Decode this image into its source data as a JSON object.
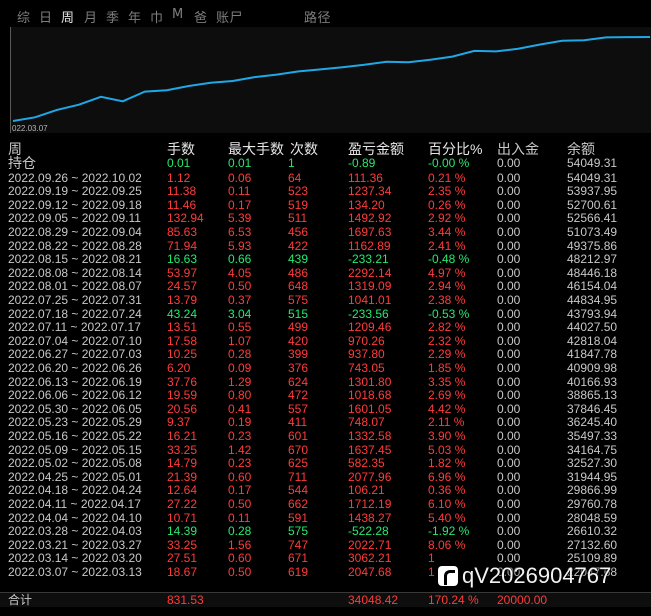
{
  "tabs": [
    {
      "label": "综",
      "active": false
    },
    {
      "label": "日",
      "active": false
    },
    {
      "label": "周",
      "active": true
    },
    {
      "label": "月",
      "active": false
    },
    {
      "label": "季",
      "active": false
    },
    {
      "label": "年",
      "active": false
    },
    {
      "label": "巾",
      "active": false
    },
    {
      "label": "M",
      "active": false
    },
    {
      "label": "爸",
      "active": false
    },
    {
      "label": "账尸",
      "active": false
    },
    {
      "label": "路径",
      "active": false
    }
  ],
  "chart": {
    "start_date": "022.03.07",
    "line_color": "#1fa8e6",
    "values": [
      20000,
      21500,
      24500,
      26600,
      29800,
      28000,
      31900,
      32500,
      34200,
      35500,
      36200,
      37800,
      38800,
      40100,
      40900,
      41800,
      42800,
      44000,
      43800,
      44800,
      46100,
      48400,
      48200,
      49300,
      51000,
      52500,
      52700,
      53900,
      54000,
      54049
    ]
  },
  "table": {
    "headers": [
      "周",
      "手数",
      "最大手数",
      "次数",
      "盈亏金额",
      "百分比%",
      "出入金",
      "余额"
    ],
    "holding": {
      "label": "持仓",
      "hands": "0.01",
      "max": "0.01",
      "count": "1",
      "pnl": "-0.89",
      "pct": "-0.00 %",
      "flow": "0.00",
      "balance": "54049.31"
    },
    "rows": [
      {
        "week": "2022.09.26 ~ 2022.10.02",
        "hands": "1.12",
        "max": "0.06",
        "count": "64",
        "pnl": "111.36",
        "pct": "0.21 %",
        "flow": "0.00",
        "balance": "54049.31",
        "sign": "pos"
      },
      {
        "week": "2022.09.19 ~ 2022.09.25",
        "hands": "11.38",
        "max": "0.11",
        "count": "523",
        "pnl": "1237.34",
        "pct": "2.35 %",
        "flow": "0.00",
        "balance": "53937.95",
        "sign": "pos"
      },
      {
        "week": "2022.09.12 ~ 2022.09.18",
        "hands": "11.46",
        "max": "0.17",
        "count": "519",
        "pnl": "134.20",
        "pct": "0.26 %",
        "flow": "0.00",
        "balance": "52700.61",
        "sign": "pos"
      },
      {
        "week": "2022.09.05 ~ 2022.09.11",
        "hands": "132.94",
        "max": "5.39",
        "count": "511",
        "pnl": "1492.92",
        "pct": "2.92 %",
        "flow": "0.00",
        "balance": "52566.41",
        "sign": "pos"
      },
      {
        "week": "2022.08.29 ~ 2022.09.04",
        "hands": "85.63",
        "max": "6.53",
        "count": "456",
        "pnl": "1697.63",
        "pct": "3.44 %",
        "flow": "0.00",
        "balance": "51073.49",
        "sign": "pos"
      },
      {
        "week": "2022.08.22 ~ 2022.08.28",
        "hands": "71.94",
        "max": "5.93",
        "count": "422",
        "pnl": "1162.89",
        "pct": "2.41 %",
        "flow": "0.00",
        "balance": "49375.86",
        "sign": "pos"
      },
      {
        "week": "2022.08.15 ~ 2022.08.21",
        "hands": "16.63",
        "max": "0.66",
        "count": "439",
        "pnl": "-233.21",
        "pct": "-0.48 %",
        "flow": "0.00",
        "balance": "48212.97",
        "sign": "neg"
      },
      {
        "week": "2022.08.08 ~ 2022.08.14",
        "hands": "53.97",
        "max": "4.05",
        "count": "486",
        "pnl": "2292.14",
        "pct": "4.97 %",
        "flow": "0.00",
        "balance": "48446.18",
        "sign": "pos"
      },
      {
        "week": "2022.08.01 ~ 2022.08.07",
        "hands": "24.57",
        "max": "0.50",
        "count": "648",
        "pnl": "1319.09",
        "pct": "2.94 %",
        "flow": "0.00",
        "balance": "46154.04",
        "sign": "pos"
      },
      {
        "week": "2022.07.25 ~ 2022.07.31",
        "hands": "13.79",
        "max": "0.37",
        "count": "575",
        "pnl": "1041.01",
        "pct": "2.38 %",
        "flow": "0.00",
        "balance": "44834.95",
        "sign": "pos"
      },
      {
        "week": "2022.07.18 ~ 2022.07.24",
        "hands": "43.24",
        "max": "3.04",
        "count": "515",
        "pnl": "-233.56",
        "pct": "-0.53 %",
        "flow": "0.00",
        "balance": "43793.94",
        "sign": "neg"
      },
      {
        "week": "2022.07.11 ~ 2022.07.17",
        "hands": "13.51",
        "max": "0.55",
        "count": "499",
        "pnl": "1209.46",
        "pct": "2.82 %",
        "flow": "0.00",
        "balance": "44027.50",
        "sign": "pos"
      },
      {
        "week": "2022.07.04 ~ 2022.07.10",
        "hands": "17.58",
        "max": "1.07",
        "count": "420",
        "pnl": "970.26",
        "pct": "2.32 %",
        "flow": "0.00",
        "balance": "42818.04",
        "sign": "pos"
      },
      {
        "week": "2022.06.27 ~ 2022.07.03",
        "hands": "10.25",
        "max": "0.28",
        "count": "399",
        "pnl": "937.80",
        "pct": "2.29 %",
        "flow": "0.00",
        "balance": "41847.78",
        "sign": "pos"
      },
      {
        "week": "2022.06.20 ~ 2022.06.26",
        "hands": "6.20",
        "max": "0.09",
        "count": "376",
        "pnl": "743.05",
        "pct": "1.85 %",
        "flow": "0.00",
        "balance": "40909.98",
        "sign": "pos"
      },
      {
        "week": "2022.06.13 ~ 2022.06.19",
        "hands": "37.76",
        "max": "1.29",
        "count": "624",
        "pnl": "1301.80",
        "pct": "3.35 %",
        "flow": "0.00",
        "balance": "40166.93",
        "sign": "pos"
      },
      {
        "week": "2022.06.06 ~ 2022.06.12",
        "hands": "19.59",
        "max": "0.80",
        "count": "472",
        "pnl": "1018.68",
        "pct": "2.69 %",
        "flow": "0.00",
        "balance": "38865.13",
        "sign": "pos"
      },
      {
        "week": "2022.05.30 ~ 2022.06.05",
        "hands": "20.56",
        "max": "0.41",
        "count": "557",
        "pnl": "1601.05",
        "pct": "4.42 %",
        "flow": "0.00",
        "balance": "37846.45",
        "sign": "pos"
      },
      {
        "week": "2022.05.23 ~ 2022.05.29",
        "hands": "9.37",
        "max": "0.19",
        "count": "411",
        "pnl": "748.07",
        "pct": "2.11 %",
        "flow": "0.00",
        "balance": "36245.40",
        "sign": "pos"
      },
      {
        "week": "2022.05.16 ~ 2022.05.22",
        "hands": "16.21",
        "max": "0.23",
        "count": "601",
        "pnl": "1332.58",
        "pct": "3.90 %",
        "flow": "0.00",
        "balance": "35497.33",
        "sign": "pos"
      },
      {
        "week": "2022.05.09 ~ 2022.05.15",
        "hands": "33.25",
        "max": "1.42",
        "count": "670",
        "pnl": "1637.45",
        "pct": "5.03 %",
        "flow": "0.00",
        "balance": "34164.75",
        "sign": "pos"
      },
      {
        "week": "2022.05.02 ~ 2022.05.08",
        "hands": "14.79",
        "max": "0.23",
        "count": "625",
        "pnl": "582.35",
        "pct": "1.82 %",
        "flow": "0.00",
        "balance": "32527.30",
        "sign": "pos"
      },
      {
        "week": "2022.04.25 ~ 2022.05.01",
        "hands": "21.39",
        "max": "0.60",
        "count": "711",
        "pnl": "2077.96",
        "pct": "6.96 %",
        "flow": "0.00",
        "balance": "31944.95",
        "sign": "pos"
      },
      {
        "week": "2022.04.18 ~ 2022.04.24",
        "hands": "12.64",
        "max": "0.17",
        "count": "544",
        "pnl": "106.21",
        "pct": "0.36 %",
        "flow": "0.00",
        "balance": "29866.99",
        "sign": "pos"
      },
      {
        "week": "2022.04.11 ~ 2022.04.17",
        "hands": "27.22",
        "max": "0.50",
        "count": "662",
        "pnl": "1712.19",
        "pct": "6.10 %",
        "flow": "0.00",
        "balance": "29760.78",
        "sign": "pos"
      },
      {
        "week": "2022.04.04 ~ 2022.04.10",
        "hands": "10.71",
        "max": "0.11",
        "count": "591",
        "pnl": "1438.27",
        "pct": "5.40 %",
        "flow": "0.00",
        "balance": "28048.59",
        "sign": "pos"
      },
      {
        "week": "2022.03.28 ~ 2022.04.03",
        "hands": "14.39",
        "max": "0.28",
        "count": "575",
        "pnl": "-522.28",
        "pct": "-1.92 %",
        "flow": "0.00",
        "balance": "26610.32",
        "sign": "neg"
      },
      {
        "week": "2022.03.21 ~ 2022.03.27",
        "hands": "33.25",
        "max": "1.56",
        "count": "747",
        "pnl": "2022.71",
        "pct": "8.06 %",
        "flow": "0.00",
        "balance": "27132.60",
        "sign": "pos"
      },
      {
        "week": "2022.03.14 ~ 2022.03.20",
        "hands": "27.51",
        "max": "0.60",
        "count": "671",
        "pnl": "3062.21",
        "pct": "1",
        "flow": "0.00",
        "balance": "25109.89",
        "sign": "pos"
      },
      {
        "week": "2022.03.07 ~ 2022.03.13",
        "hands": "18.67",
        "max": "0.50",
        "count": "619",
        "pnl": "2047.68",
        "pct": "1",
        "flow": "0.00",
        "balance": "22047.68",
        "sign": "pos"
      }
    ],
    "total": {
      "label": "合计",
      "hands": "831.53",
      "pnl": "34048.42",
      "pct": "170.24 %",
      "flow": "20000.00"
    }
  },
  "watermark": "qV2026904767"
}
